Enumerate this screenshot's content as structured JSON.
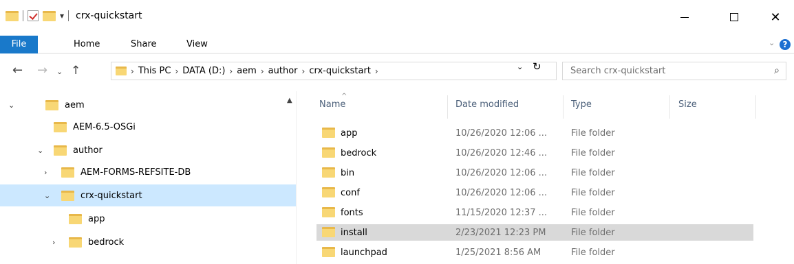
{
  "window": {
    "title": "crx-quickstart",
    "qat_dropdown": "▾",
    "close": "✕"
  },
  "ribbon": {
    "tabs": [
      "File",
      "Home",
      "Share",
      "View"
    ]
  },
  "nav": {
    "back": "←",
    "forward": "→",
    "recent": "⌄",
    "up": "↑"
  },
  "address": {
    "crumbs": [
      "This PC",
      "DATA (D:)",
      "aem",
      "author",
      "crx-quickstart"
    ],
    "separator": "›",
    "dropdown": "⌄",
    "refresh": "↻"
  },
  "search": {
    "placeholder": "Search crx-quickstart",
    "icon": "⌕"
  },
  "tree": [
    {
      "label": "aem",
      "expander": "⌄"
    },
    {
      "label": "AEM-6.5-OSGi",
      "expander": ""
    },
    {
      "label": "author",
      "expander": "⌄"
    },
    {
      "label": "AEM-FORMS-REFSITE-DB",
      "expander": "›"
    },
    {
      "label": "crx-quickstart",
      "expander": "⌄"
    },
    {
      "label": "app",
      "expander": ""
    },
    {
      "label": "bedrock",
      "expander": "›"
    }
  ],
  "columns": {
    "name": "Name",
    "date": "Date modified",
    "type": "Type",
    "size": "Size"
  },
  "files": [
    {
      "name": "app",
      "date": "10/26/2020 12:06 ...",
      "type": "File folder"
    },
    {
      "name": "bedrock",
      "date": "10/26/2020 12:46 ...",
      "type": "File folder"
    },
    {
      "name": "bin",
      "date": "10/26/2020 12:06 ...",
      "type": "File folder"
    },
    {
      "name": "conf",
      "date": "10/26/2020 12:06 ...",
      "type": "File folder"
    },
    {
      "name": "fonts",
      "date": "11/15/2020 12:37 ...",
      "type": "File folder"
    },
    {
      "name": "install",
      "date": "2/23/2021 12:23 PM",
      "type": "File folder"
    },
    {
      "name": "launchpad",
      "date": "1/25/2021 8:56 AM",
      "type": "File folder"
    }
  ],
  "colors": {
    "accent": "#1979ca",
    "selection": "#cce8ff",
    "folder": "#f8d775"
  }
}
